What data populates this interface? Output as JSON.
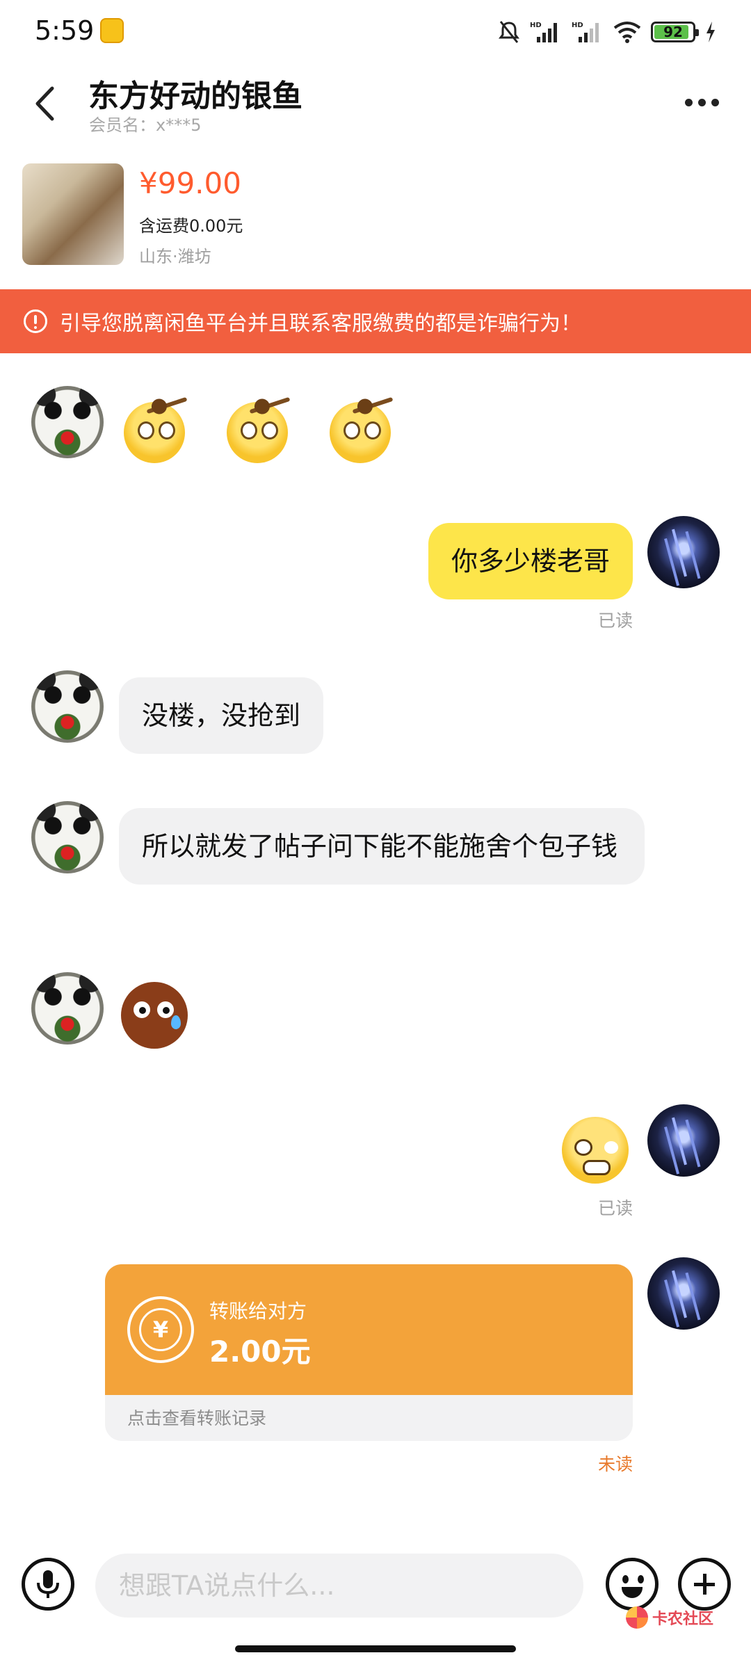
{
  "status_bar": {
    "time": "5:59",
    "battery_level": "92",
    "indicators": [
      "mute-icon",
      "hd-signal-icon",
      "hd-signal-icon",
      "wifi-icon",
      "battery-icon",
      "charging-icon"
    ]
  },
  "header": {
    "title": "东方好动的银鱼",
    "subtitle": "会员名：x***5"
  },
  "product": {
    "price": "¥99.00",
    "shipping": "含运费0.00元",
    "location": "山东·潍坊"
  },
  "warning": {
    "text": "引导您脱离闲鱼平台并且联系客服缴费的都是诈骗行为！",
    "color": "#f15f3f"
  },
  "messages": {
    "m2_text": "你多少楼老哥",
    "m2_status": "已读",
    "m3_text": "没楼，没抢到",
    "m4_text": "所以就发了帖子问下能不能施舍个包子钱",
    "m6_status": "已读",
    "transfer": {
      "label": "转账给对方",
      "amount": "2.00元",
      "footer": "点击查看转账记录",
      "status": "未读",
      "color": "#f3a33a"
    }
  },
  "input_bar": {
    "placeholder": "想跟TA说点什么..."
  },
  "watermark": {
    "text": "卡农社区"
  },
  "colors": {
    "price": "#ff5b2e",
    "out_bubble": "#fde54a",
    "in_bubble": "#f1f1f2",
    "unread": "#e87a2c"
  }
}
